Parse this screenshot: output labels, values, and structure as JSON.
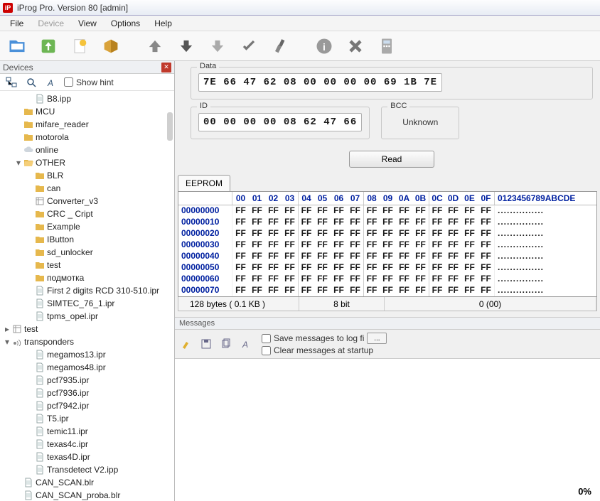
{
  "title": "iProg Pro. Version 80 [admin]",
  "menu": [
    "File",
    "Device",
    "View",
    "Options",
    "Help"
  ],
  "menu_dim_index": 1,
  "devices_header": "Devices",
  "show_hint": "Show hint",
  "tree": [
    {
      "d": 2,
      "tw": "",
      "icon": "file",
      "label": "B8.ipp"
    },
    {
      "d": 1,
      "tw": "",
      "icon": "folder",
      "label": "MCU"
    },
    {
      "d": 1,
      "tw": "",
      "icon": "folder",
      "label": "mifare_reader"
    },
    {
      "d": 1,
      "tw": "",
      "icon": "folder",
      "label": "motorola"
    },
    {
      "d": 1,
      "tw": "",
      "icon": "cloud",
      "label": "online"
    },
    {
      "d": 1,
      "tw": "▾",
      "icon": "folder-open",
      "label": "OTHER"
    },
    {
      "d": 2,
      "tw": "",
      "icon": "folder",
      "label": "BLR"
    },
    {
      "d": 2,
      "tw": "",
      "icon": "folder",
      "label": "can"
    },
    {
      "d": 2,
      "tw": "",
      "icon": "box",
      "label": "Converter_v3"
    },
    {
      "d": 2,
      "tw": "",
      "icon": "folder",
      "label": "CRC _ Cript"
    },
    {
      "d": 2,
      "tw": "",
      "icon": "folder",
      "label": "Example"
    },
    {
      "d": 2,
      "tw": "",
      "icon": "folder",
      "label": "IButton"
    },
    {
      "d": 2,
      "tw": "",
      "icon": "folder",
      "label": "sd_unlocker"
    },
    {
      "d": 2,
      "tw": "",
      "icon": "folder",
      "label": "test"
    },
    {
      "d": 2,
      "tw": "",
      "icon": "folder",
      "label": "подмотка"
    },
    {
      "d": 2,
      "tw": "",
      "icon": "file",
      "label": "First 2 digits RCD 310-510.ipr"
    },
    {
      "d": 2,
      "tw": "",
      "icon": "file",
      "label": "SIMTEC_76_1.ipr"
    },
    {
      "d": 2,
      "tw": "",
      "icon": "file",
      "label": "tpms_opel.ipr"
    },
    {
      "d": 0,
      "tw": "▸",
      "icon": "box",
      "label": "test"
    },
    {
      "d": 0,
      "tw": "▾",
      "icon": "radio",
      "label": "transponders"
    },
    {
      "d": 2,
      "tw": "",
      "icon": "file",
      "label": "megamos13.ipr"
    },
    {
      "d": 2,
      "tw": "",
      "icon": "file",
      "label": "megamos48.ipr"
    },
    {
      "d": 2,
      "tw": "",
      "icon": "file",
      "label": "pcf7935.ipr"
    },
    {
      "d": 2,
      "tw": "",
      "icon": "file",
      "label": "pcf7936.ipr"
    },
    {
      "d": 2,
      "tw": "",
      "icon": "file",
      "label": "pcf7942.ipr"
    },
    {
      "d": 2,
      "tw": "",
      "icon": "file",
      "label": "T5.ipr"
    },
    {
      "d": 2,
      "tw": "",
      "icon": "file",
      "label": "temic11.ipr"
    },
    {
      "d": 2,
      "tw": "",
      "icon": "file",
      "label": "texas4c.ipr"
    },
    {
      "d": 2,
      "tw": "",
      "icon": "file",
      "label": "texas4D.ipr"
    },
    {
      "d": 2,
      "tw": "",
      "icon": "file",
      "label": "Transdetect V2.ipp"
    },
    {
      "d": 1,
      "tw": "",
      "icon": "file",
      "label": "CAN_SCAN.blr"
    },
    {
      "d": 1,
      "tw": "",
      "icon": "file",
      "label": "CAN_SCAN_proba.blr"
    }
  ],
  "data_label": "Data",
  "data_value": "7E 66 47 62 08 00 00 00 00 69 1B 7E",
  "id_label": "ID",
  "id_value": "00 00 00 00 08 62 47 66",
  "bcc_label": "BCC",
  "bcc_value": "Unknown",
  "read_btn": "Read",
  "eeprom_tab": "EEPROM",
  "hex_cols": [
    "00",
    "01",
    "02",
    "03",
    "04",
    "05",
    "06",
    "07",
    "08",
    "09",
    "0A",
    "0B",
    "0C",
    "0D",
    "0E",
    "0F"
  ],
  "hex_ascii_header": "0123456789ABCDE",
  "hex_rows": [
    {
      "addr": "00000000",
      "vals": [
        "FF",
        "FF",
        "FF",
        "FF",
        "FF",
        "FF",
        "FF",
        "FF",
        "FF",
        "FF",
        "FF",
        "FF",
        "FF",
        "FF",
        "FF",
        "FF"
      ],
      "ascii": "..............."
    },
    {
      "addr": "00000010",
      "vals": [
        "FF",
        "FF",
        "FF",
        "FF",
        "FF",
        "FF",
        "FF",
        "FF",
        "FF",
        "FF",
        "FF",
        "FF",
        "FF",
        "FF",
        "FF",
        "FF"
      ],
      "ascii": "..............."
    },
    {
      "addr": "00000020",
      "vals": [
        "FF",
        "FF",
        "FF",
        "FF",
        "FF",
        "FF",
        "FF",
        "FF",
        "FF",
        "FF",
        "FF",
        "FF",
        "FF",
        "FF",
        "FF",
        "FF"
      ],
      "ascii": "..............."
    },
    {
      "addr": "00000030",
      "vals": [
        "FF",
        "FF",
        "FF",
        "FF",
        "FF",
        "FF",
        "FF",
        "FF",
        "FF",
        "FF",
        "FF",
        "FF",
        "FF",
        "FF",
        "FF",
        "FF"
      ],
      "ascii": "..............."
    },
    {
      "addr": "00000040",
      "vals": [
        "FF",
        "FF",
        "FF",
        "FF",
        "FF",
        "FF",
        "FF",
        "FF",
        "FF",
        "FF",
        "FF",
        "FF",
        "FF",
        "FF",
        "FF",
        "FF"
      ],
      "ascii": "..............."
    },
    {
      "addr": "00000050",
      "vals": [
        "FF",
        "FF",
        "FF",
        "FF",
        "FF",
        "FF",
        "FF",
        "FF",
        "FF",
        "FF",
        "FF",
        "FF",
        "FF",
        "FF",
        "FF",
        "FF"
      ],
      "ascii": "..............."
    },
    {
      "addr": "00000060",
      "vals": [
        "FF",
        "FF",
        "FF",
        "FF",
        "FF",
        "FF",
        "FF",
        "FF",
        "FF",
        "FF",
        "FF",
        "FF",
        "FF",
        "FF",
        "FF",
        "FF"
      ],
      "ascii": "..............."
    },
    {
      "addr": "00000070",
      "vals": [
        "FF",
        "FF",
        "FF",
        "FF",
        "FF",
        "FF",
        "FF",
        "FF",
        "FF",
        "FF",
        "FF",
        "FF",
        "FF",
        "FF",
        "FF",
        "FF"
      ],
      "ascii": "..............."
    }
  ],
  "status": {
    "size": "128 bytes ( 0.1 KB )",
    "bits": "8 bit",
    "pos": "0 (00)"
  },
  "messages_header": "Messages",
  "save_log": "Save messages to log fi",
  "clear_startup": "Clear messages at startup",
  "small_btn": "...",
  "progress": "0%"
}
